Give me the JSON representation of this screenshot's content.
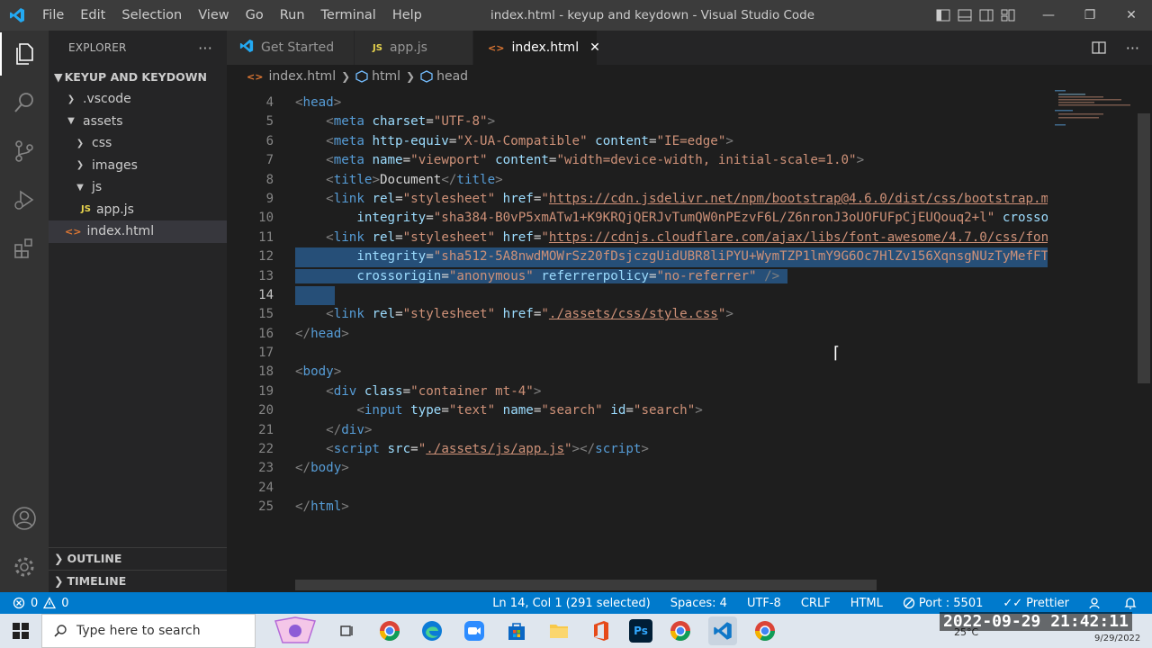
{
  "titlebar": {
    "menu": [
      "File",
      "Edit",
      "Selection",
      "View",
      "Go",
      "Run",
      "Terminal",
      "Help"
    ],
    "title": "index.html - keyup and keydown - Visual Studio Code"
  },
  "sidebar": {
    "header": "EXPLORER",
    "more": "···",
    "project": "KEYUP AND KEYDOWN",
    "tree": [
      {
        "label": ".vscode"
      },
      {
        "label": "assets"
      },
      {
        "label": "css"
      },
      {
        "label": "images"
      },
      {
        "label": "js"
      },
      {
        "label": "app.js",
        "badge": "JS"
      },
      {
        "label": "index.html",
        "badge": "<>"
      }
    ],
    "outline": "OUTLINE",
    "timeline": "TIMELINE"
  },
  "tabs": [
    {
      "label": "Get Started"
    },
    {
      "label": "app.js",
      "badge": "JS"
    },
    {
      "label": "index.html",
      "badge": "<>",
      "close": "✕"
    }
  ],
  "breadcrumb": {
    "file": "index.html",
    "file_icon": "<>",
    "items": [
      "html",
      "head"
    ]
  },
  "editor": {
    "line_numbers": [
      "4",
      "5",
      "6",
      "7",
      "8",
      "9",
      "10",
      "11",
      "12",
      "13",
      "14",
      "15",
      "16",
      "17",
      "18",
      "19",
      "20",
      "21",
      "22",
      "23",
      "24",
      "25"
    ]
  },
  "statusbar": {
    "errors": "0",
    "warnings": "0",
    "position": "Ln 14, Col 1 (291 selected)",
    "spaces": "Spaces: 4",
    "encoding": "UTF-8",
    "eol": "CRLF",
    "language": "HTML",
    "port": "Port : 5501",
    "prettier": "Prettier"
  },
  "taskbar": {
    "search_placeholder": "Type here to search",
    "weather": "25°C",
    "date": "9/29/2022"
  },
  "overlay": {
    "timestamp": "2022-09-29  21:42:11"
  },
  "colors": {
    "accent": "#007acc",
    "titlebar": "#3c3c3c",
    "editor_bg": "#1e1e1e",
    "selection": "#264f78"
  }
}
